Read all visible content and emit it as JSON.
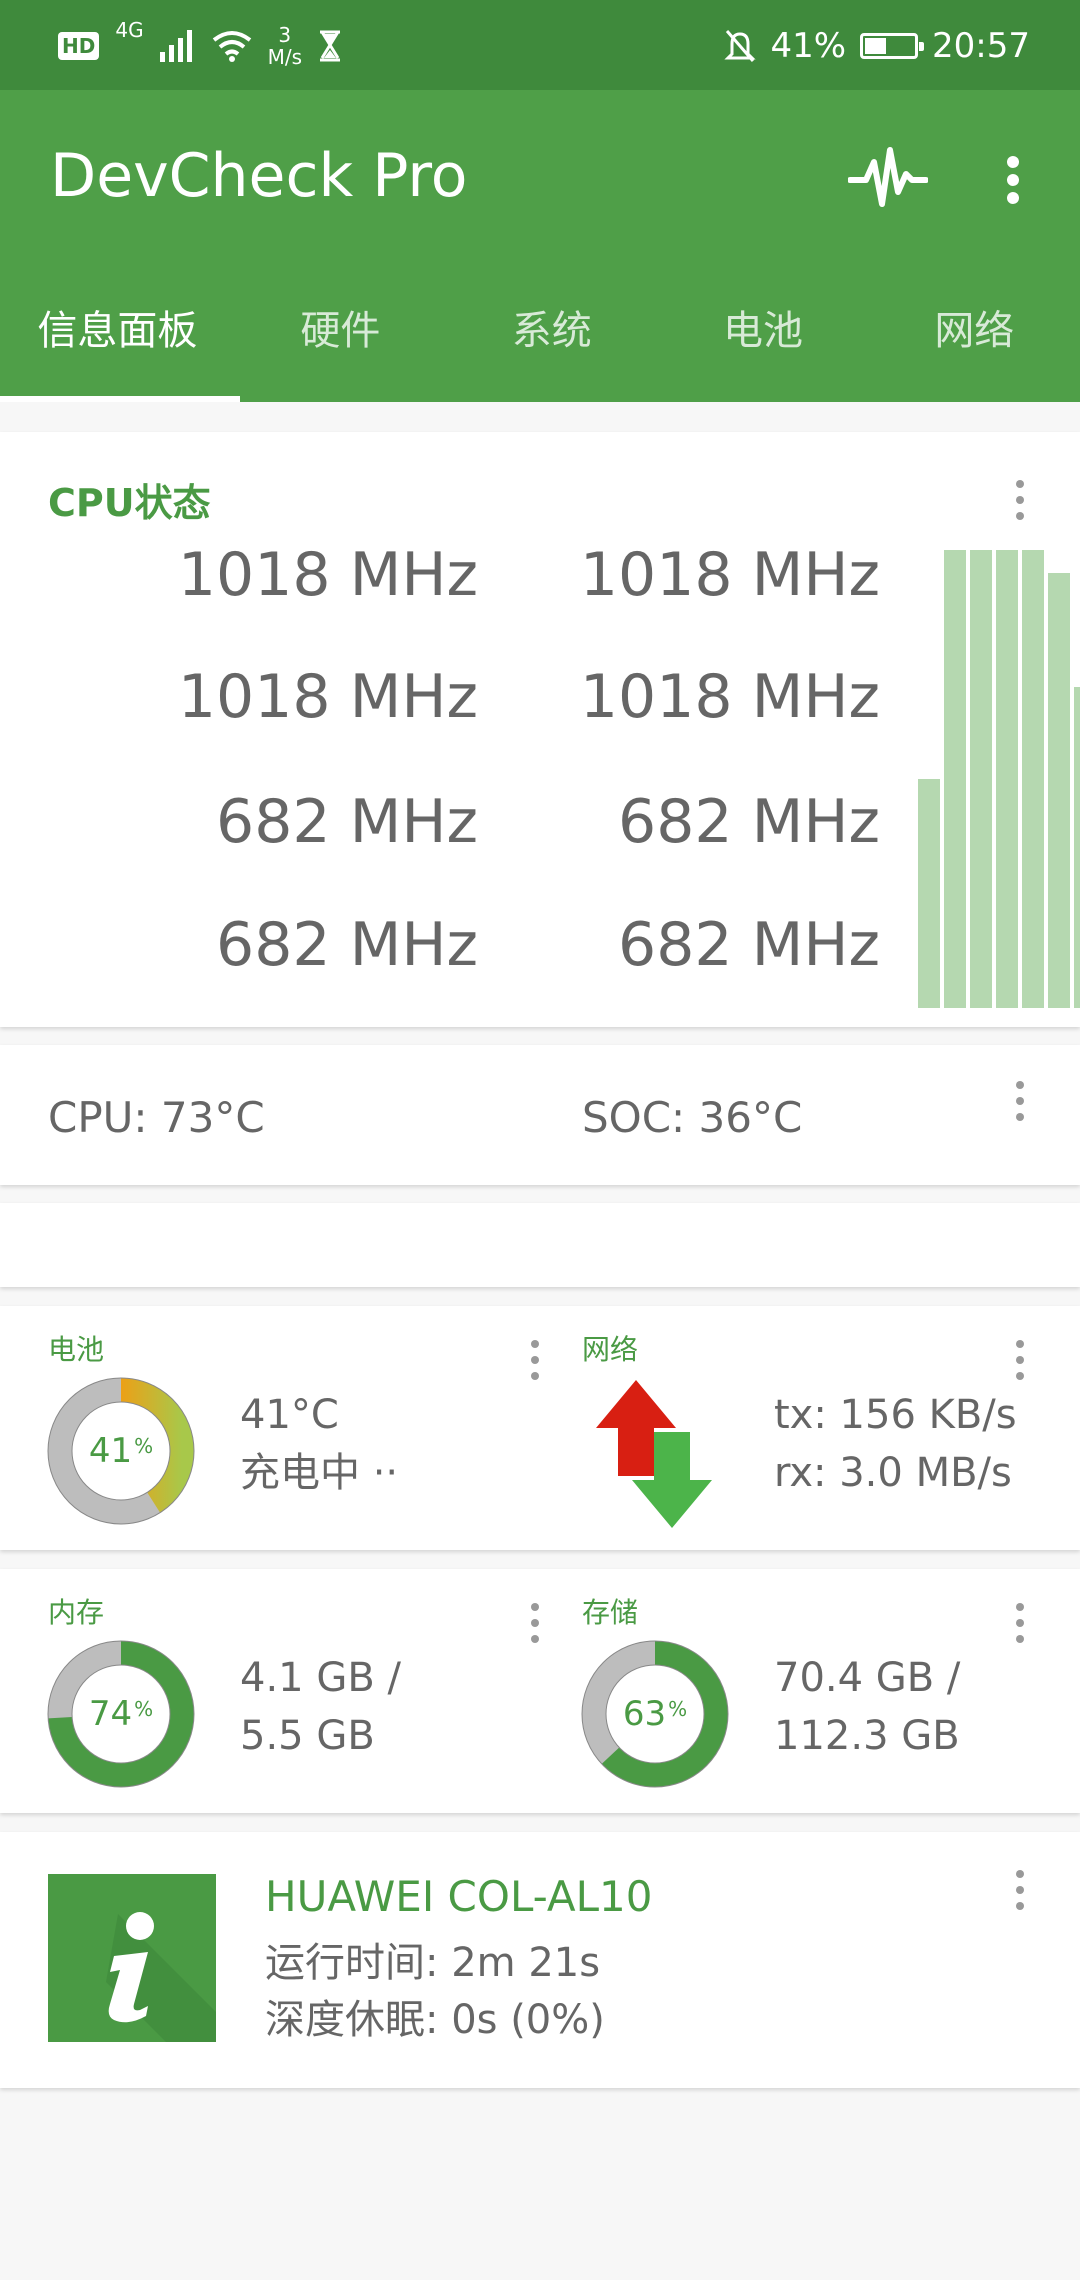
{
  "status_bar": {
    "hd": "HD",
    "network": "4G",
    "speed_value": "3",
    "speed_unit": "M/s",
    "battery_percent": "41%",
    "battery_level": 0.41,
    "time": "20:57"
  },
  "app": {
    "title": "DevCheck Pro",
    "tabs": [
      "信息面板",
      "硬件",
      "系统",
      "电池",
      "网络"
    ],
    "active_tab": 0
  },
  "cpu_card": {
    "title": "CPU状态",
    "frequencies": [
      "1018 MHz",
      "1018 MHz",
      "1018 MHz",
      "1018 MHz",
      "682 MHz",
      "682 MHz",
      "682 MHz",
      "682 MHz"
    ],
    "bar_levels": [
      0.5,
      1.0,
      1.0,
      1.0,
      1.0,
      0.95,
      0.7
    ]
  },
  "temp_card": {
    "cpu": "CPU: 73°C",
    "soc": "SOC: 36°C"
  },
  "battery_card": {
    "label": "电池",
    "percent": "41",
    "unit": "%",
    "level": 0.41,
    "temp": "41°C",
    "status": "充电中 ··"
  },
  "network_card": {
    "label": "网络",
    "tx": "tx: 156 KB/s",
    "rx": "rx: 3.0 MB/s"
  },
  "memory_card": {
    "label": "内存",
    "percent": "74",
    "unit": "%",
    "level": 0.74,
    "line1": "4.1 GB /",
    "line2": "5.5 GB"
  },
  "storage_card": {
    "label": "存储",
    "percent": "63",
    "unit": "%",
    "level": 0.63,
    "line1": "70.4 GB /",
    "line2": "112.3 GB"
  },
  "device_card": {
    "name": "HUAWEI COL-AL10",
    "uptime": "运行时间: 2m 21s",
    "deep_sleep": "深度休眠: 0s (0%)"
  },
  "colors": {
    "primary": "#4f9f48",
    "status_bar": "#3f8a3c",
    "accent_text": "#4a9a44",
    "bar_fill": "#b5d8b0",
    "donut_gray": "#bdbdbd",
    "donut_green": "#4a9a44",
    "arrow_up": "#d81f12",
    "arrow_down": "#4cb44a"
  }
}
